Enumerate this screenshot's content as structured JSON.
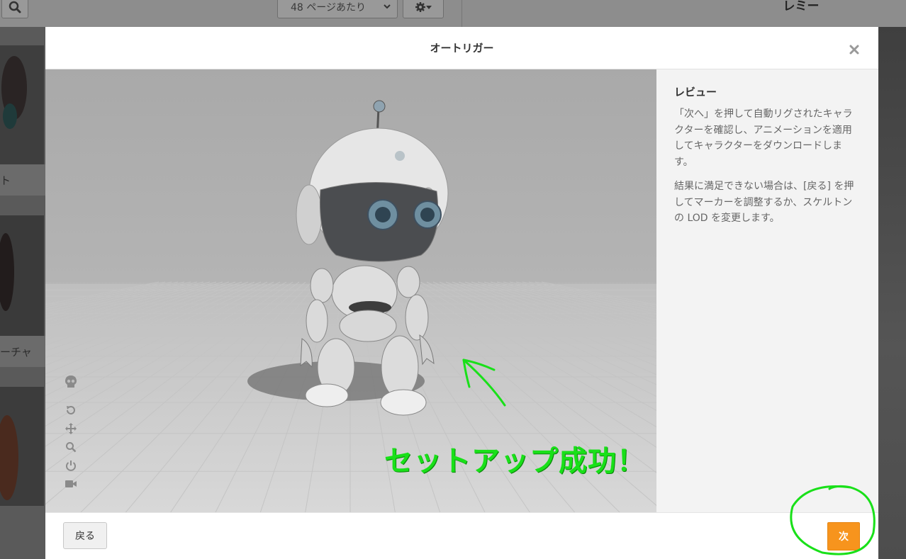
{
  "background": {
    "per_page_label": "48 ページあたり",
    "right_panel_title": "レミー",
    "left_labels": [
      "ト",
      "ーチャ"
    ]
  },
  "modal": {
    "title": "オートリガー",
    "close_symbol": "×"
  },
  "viewport": {
    "tools": [
      "skeleton-icon",
      "reset-rotate-icon",
      "pan-icon",
      "zoom-icon",
      "power-icon",
      "camera-icon"
    ],
    "overlay_text": "セットアップ成功！",
    "overlay_color": "#19e019"
  },
  "side_panel": {
    "title": "レビュー",
    "paragraph1": "「次へ」を押して自動リグされたキャラクターを確認し、アニメーションを適用してキャラクターをダウンロードします。",
    "paragraph2": "結果に満足できない場合は、[戻る] を押してマーカーを調整するか、スケルトンの LOD を変更します。"
  },
  "footer": {
    "back_label": "戻る",
    "next_label": "次",
    "next_color": "#f7941d"
  }
}
